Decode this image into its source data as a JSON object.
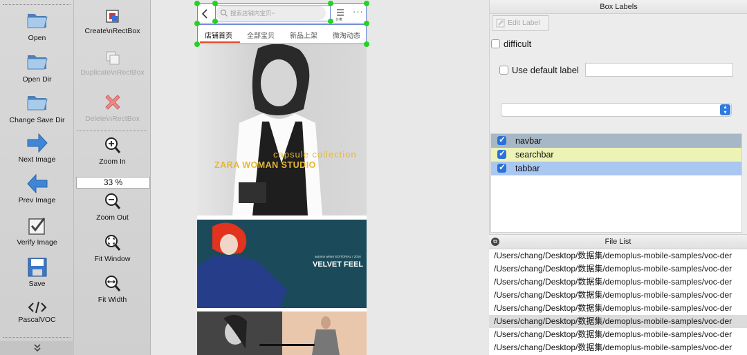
{
  "toolbar_left": {
    "open": "Open",
    "open_dir": "Open Dir",
    "change_save_dir": "Change Save Dir",
    "next_image": "Next Image",
    "prev_image": "Prev Image",
    "verify_image": "Verify Image",
    "save": "Save",
    "pascal_voc": "PascalVOC",
    "expand": "»"
  },
  "toolbar_right": {
    "create_rect_box": "Create\\nRectBox",
    "duplicate_rect_box": "Duplicate\\nRectBox",
    "delete_rect_box": "Delete\\nRectBox",
    "zoom_in": "Zoom In",
    "zoom_value": "33 %",
    "zoom_out": "Zoom Out",
    "fit_window": "Fit Window",
    "fit_width": "Fit Width"
  },
  "phone": {
    "search_placeholder": "搜索店铺内宝贝~",
    "category_label": "分类",
    "tabs": [
      "店铺首页",
      "全部宝贝",
      "新品上架",
      "微淘动态"
    ],
    "banner1_line1": "capsule collection",
    "banner1_line2": "ZARA WOMAN STUDIO",
    "banner2_small": "autumn winter EDITORIAL / 2016",
    "banner2_big": "VELVET FEEL"
  },
  "box_labels": {
    "title": "Box Labels",
    "edit_label": "Edit Label",
    "difficult": "difficult",
    "use_default_label": "Use default label",
    "default_label_value": "",
    "labels": [
      {
        "name": "navbar",
        "checked": true,
        "color": "#a7b7c5"
      },
      {
        "name": "searchbar",
        "checked": true,
        "color": "#ecf3b5"
      },
      {
        "name": "tabbar",
        "checked": true,
        "color": "#aac7f2"
      }
    ]
  },
  "file_list": {
    "title": "File List",
    "files": [
      "/Users/chang/Desktop/数据集/demoplus-mobile-samples/voc-der",
      "/Users/chang/Desktop/数据集/demoplus-mobile-samples/voc-der",
      "/Users/chang/Desktop/数据集/demoplus-mobile-samples/voc-der",
      "/Users/chang/Desktop/数据集/demoplus-mobile-samples/voc-der",
      "/Users/chang/Desktop/数据集/demoplus-mobile-samples/voc-der",
      "/Users/chang/Desktop/数据集/demoplus-mobile-samples/voc-der",
      "/Users/chang/Desktop/数据集/demoplus-mobile-samples/voc-der",
      "/Users/chang/Desktop/数据集/demoplus-mobile-samples/voc-der"
    ],
    "selected_index": 5
  }
}
